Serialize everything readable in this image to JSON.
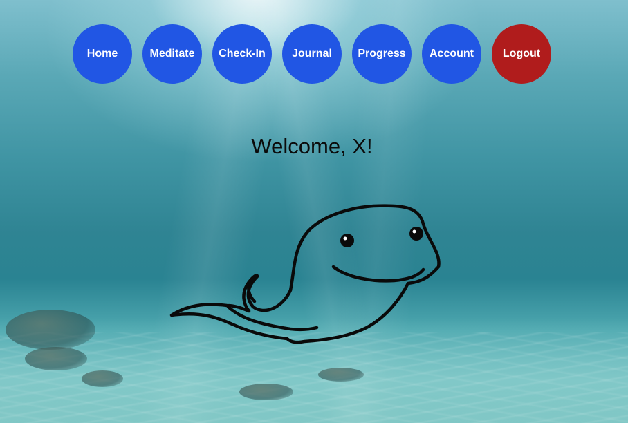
{
  "nav": {
    "items": [
      {
        "label": "Home"
      },
      {
        "label": "Meditate"
      },
      {
        "label": "Check-In"
      },
      {
        "label": "Journal"
      },
      {
        "label": "Progress"
      },
      {
        "label": "Account"
      },
      {
        "label": "Logout"
      }
    ]
  },
  "main": {
    "welcome_text": "Welcome, X!"
  },
  "colors": {
    "nav_button": "#2156e4",
    "logout_button": "#b01c1c",
    "text": "#0b0b0b"
  },
  "icons": {
    "mascot": "whale-icon"
  }
}
